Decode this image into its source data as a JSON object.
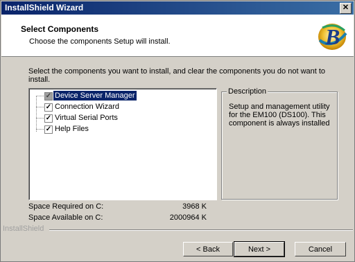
{
  "window": {
    "title": "InstallShield Wizard",
    "close_glyph": "✕"
  },
  "header": {
    "title": "Select Components",
    "subtitle": "Choose the components Setup will install."
  },
  "instructions": "Select the components you want to install, and clear the components you do not want to install.",
  "components": [
    {
      "label": "Device Server Manager",
      "checked": true,
      "selected": true,
      "grayed": true
    },
    {
      "label": "Connection Wizard",
      "checked": true,
      "selected": false,
      "grayed": false
    },
    {
      "label": "Virtual Serial Ports",
      "checked": true,
      "selected": false,
      "grayed": false
    },
    {
      "label": "Help Files",
      "checked": true,
      "selected": false,
      "grayed": false
    }
  ],
  "description": {
    "legend": "Description",
    "text": "Setup and management utility for the EM100 (DS100). This component is always installed"
  },
  "space": {
    "required_label": "Space Required on  C:",
    "required_value": "3968 K",
    "available_label": "Space Available on  C:",
    "available_value": "2000964 K"
  },
  "brand": "InstallShield",
  "buttons": {
    "back": "< Back",
    "next": "Next >",
    "cancel": "Cancel"
  },
  "colors": {
    "title_bar": "#0a246a",
    "dialog_bg": "#d4d0c8",
    "selection": "#0a246a"
  },
  "icons": {
    "logo": "installshield-b-logo",
    "check": "✓"
  }
}
